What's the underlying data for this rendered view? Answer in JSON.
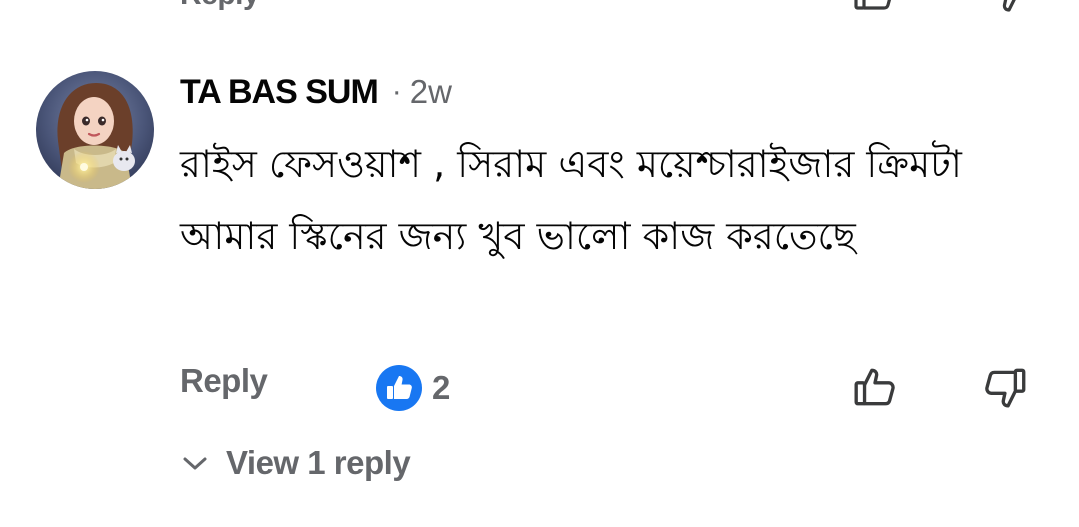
{
  "previous_comment": {
    "reply_label": "Reply",
    "like_icon": "thumbs-up-outline-icon",
    "dislike_icon": "thumbs-down-outline-icon"
  },
  "comment": {
    "avatar_icon": "profile-avatar",
    "author": "TA BAS SUM",
    "separator": "·",
    "time": "2w",
    "text": "রাইস ফেসওয়াশ , সিরাম এবং ময়েশ্চারাইজার ক্রিমটা আমার স্কিনের জন্য খুব ভালো কাজ করতেছে",
    "reply_label": "Reply",
    "reaction_icon": "like-reaction-icon",
    "reaction_count": "2",
    "like_icon": "thumbs-up-outline-icon",
    "dislike_icon": "thumbs-down-outline-icon"
  },
  "replies": {
    "view_label": "View 1 reply",
    "chevron_icon": "chevron-down-icon"
  },
  "colors": {
    "text_primary": "#050505",
    "text_secondary": "#65676b",
    "reaction_blue": "#1877f2"
  }
}
